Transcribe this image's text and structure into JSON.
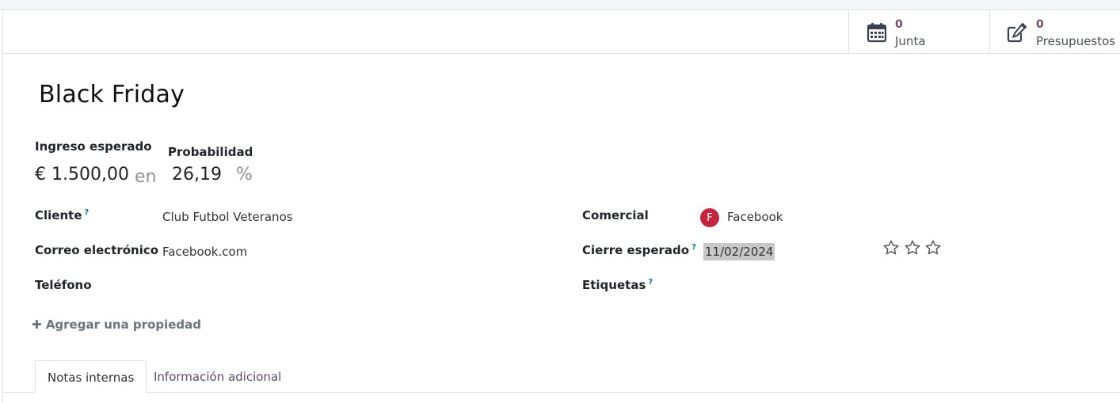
{
  "stat_buttons": [
    {
      "count": "0",
      "label": "Junta",
      "icon": "calendar-icon"
    },
    {
      "count": "0",
      "label": "Presupuestos",
      "icon": "edit-icon"
    }
  ],
  "title": "Black Friday",
  "revenue": {
    "label": "Ingreso esperado",
    "value": "€ 1.500,00",
    "connector": "en"
  },
  "probability": {
    "label": "Probabilidad",
    "value": "26,19",
    "unit": "%"
  },
  "left_fields": {
    "client_label": "Cliente",
    "client_help": "?",
    "client_value": "Club Futbol Veteranos",
    "email_label": "Correo electrónico",
    "email_value": "Facebook.com",
    "phone_label": "Teléfono"
  },
  "right_fields": {
    "salesperson_label": "Comercial",
    "salesperson_initial": "F",
    "salesperson_value": "Facebook",
    "close_label": "Cierre esperado",
    "close_help": "?",
    "close_value": "11/02/2024",
    "tags_label": "Etiquetas",
    "tags_help": "?"
  },
  "priority": {
    "stars": 3,
    "filled": 0
  },
  "add_property": "Agregar una propiedad",
  "tabs": [
    {
      "label": "Notas internas",
      "active": true
    },
    {
      "label": "Información adicional",
      "active": false
    }
  ],
  "colors": {
    "accent": "#714b67",
    "avatar": "#c3253e",
    "help": "#017e84"
  }
}
